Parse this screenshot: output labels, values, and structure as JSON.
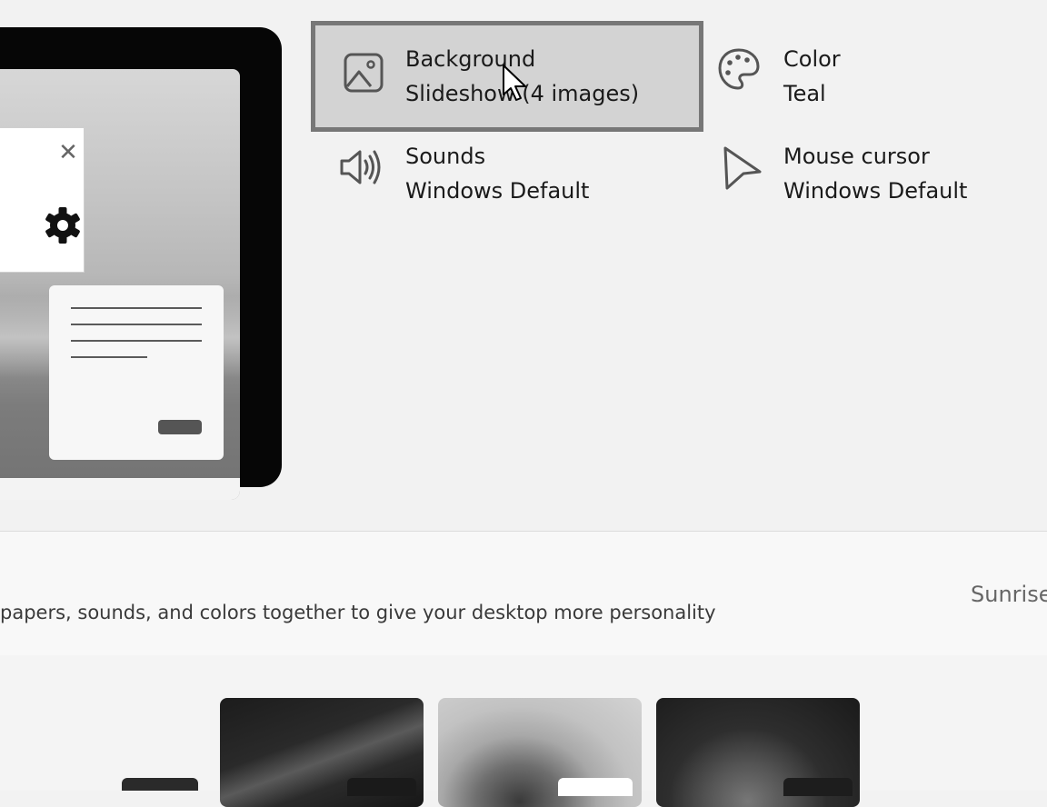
{
  "tiles": {
    "background": {
      "title": "Background",
      "value": "Slideshow (4 images)",
      "icon": "picture-icon"
    },
    "color": {
      "title": "Color",
      "value": "Teal",
      "icon": "palette-icon"
    },
    "sounds": {
      "title": "Sounds",
      "value": "Windows Default",
      "icon": "speaker-icon"
    },
    "mouse_cursor": {
      "title": "Mouse cursor",
      "value": "Windows Default",
      "icon": "cursor-arrow-icon"
    }
  },
  "themes": {
    "description": "papers, sounds, and colors together to give your desktop more personality",
    "right_label": "Sunrise"
  },
  "colors": {
    "background": "#f2f2f2",
    "tile_selected": "#d3d3d3",
    "tile_selected_border": "#777777"
  }
}
